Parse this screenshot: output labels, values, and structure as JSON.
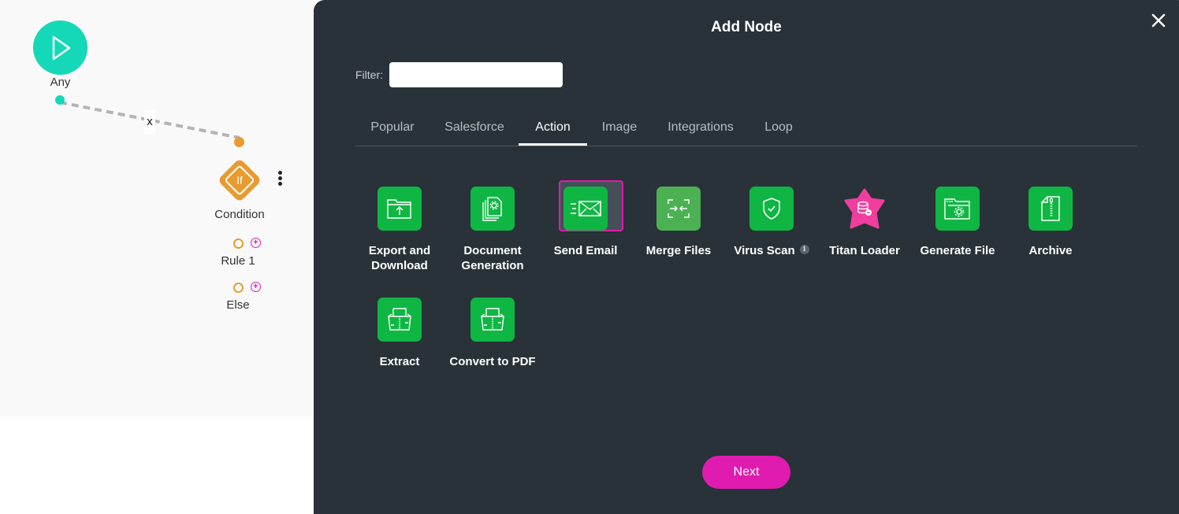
{
  "canvas": {
    "start_node": {
      "label": "Any",
      "icon": "play-icon",
      "color": "#14d8b7"
    },
    "edge": {
      "remove_label": "x"
    },
    "condition_node": {
      "label": "Condition",
      "icon_text": "If",
      "color": "#e99b30"
    },
    "branches": [
      {
        "label": "Rule 1"
      },
      {
        "label": "Else"
      }
    ],
    "plus_glyph": "+"
  },
  "modal": {
    "title": "Add Node",
    "close_icon": "close-icon",
    "filter": {
      "label": "Filter:",
      "value": "",
      "placeholder": ""
    },
    "tabs": [
      {
        "label": "Popular",
        "active": false
      },
      {
        "label": "Salesforce",
        "active": false
      },
      {
        "label": "Action",
        "active": true
      },
      {
        "label": "Image",
        "active": false
      },
      {
        "label": "Integrations",
        "active": false
      },
      {
        "label": "Loop",
        "active": false
      }
    ],
    "items": [
      {
        "label": "Export and Download",
        "icon": "folder-upload-icon"
      },
      {
        "label": "Document Generation",
        "icon": "document-gear-icon"
      },
      {
        "label": "Send Email",
        "icon": "email-send-icon",
        "selected": true
      },
      {
        "label": "Merge Files",
        "icon": "merge-icon"
      },
      {
        "label": "Virus Scan",
        "icon": "shield-check-icon",
        "info": "i"
      },
      {
        "label": "Titan Loader",
        "icon": "database-star-icon"
      },
      {
        "label": "Generate File",
        "icon": "folder-gear-icon"
      },
      {
        "label": "Archive",
        "icon": "zip-file-icon"
      },
      {
        "label": "Extract",
        "icon": "extract-box-icon"
      },
      {
        "label": "Convert to PDF",
        "icon": "convert-box-icon"
      }
    ],
    "next_label": "Next",
    "accent_color": "#e01bb0",
    "tile_color": "#10b643"
  }
}
